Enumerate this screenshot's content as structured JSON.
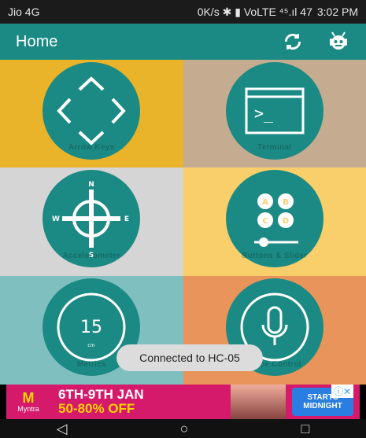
{
  "status_bar": {
    "carrier": "Jio 4G",
    "indicators": "0K/s ✱ ▮ VoLTE ⁴⁵.ıl 47",
    "time": "3:02 PM"
  },
  "app_bar": {
    "title": "Home",
    "sync_icon": "sync-icon",
    "robot_icon": "robot-icon"
  },
  "tiles": [
    {
      "label": "Arrow Keys",
      "color": "#e9b32a",
      "icon": "arrow-keys-icon"
    },
    {
      "label": "Terminal",
      "color": "#c5ab8f",
      "icon": "terminal-icon"
    },
    {
      "label": "Accelerometer",
      "color": "#d5d5d5",
      "icon": "compass-icon"
    },
    {
      "label": "Buttons & Slider",
      "color": "#f8cf6a",
      "icon": "buttons-slider-icon"
    },
    {
      "label": "Metrics",
      "color": "#7fbfc0",
      "icon": "metrics-icon",
      "metric_value": "15",
      "metric_unit": "cm"
    },
    {
      "label": "Voice Control",
      "color": "#e8945a",
      "icon": "microphone-icon"
    }
  ],
  "compass": {
    "n": "N",
    "s": "S",
    "e": "E",
    "w": "W"
  },
  "terminal_prompt": ">_",
  "ab_labels": [
    "A",
    "B",
    "C",
    "D"
  ],
  "toast": "Connected to HC-05",
  "ad": {
    "brand": "Myntra",
    "dates": "6TH-9TH JAN",
    "offer": "50-80% OFF",
    "cta_line1": "STARTS",
    "cta_line2": "MIDNIGHT",
    "close": "ⓘ✕"
  },
  "nav": {
    "back": "◁",
    "home": "○",
    "recent": "□"
  }
}
